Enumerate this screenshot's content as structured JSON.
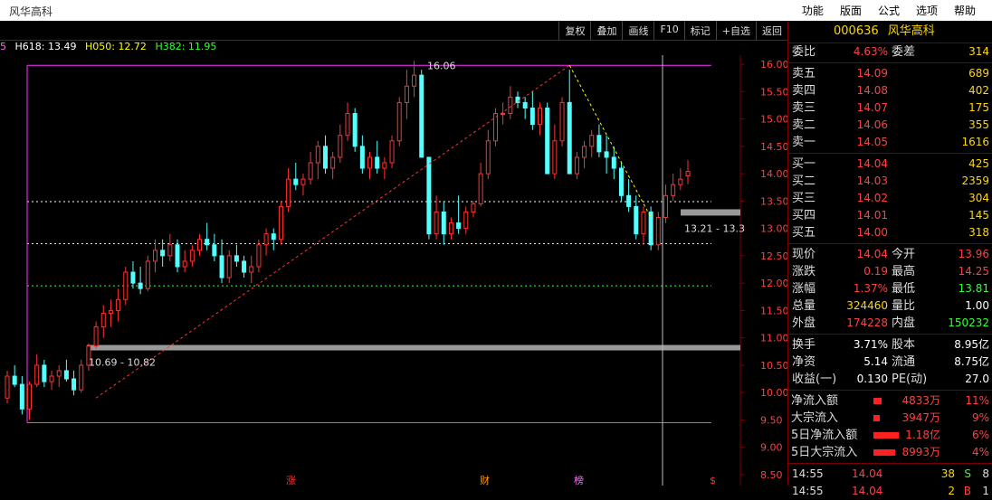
{
  "window": {
    "title": "风华高科"
  },
  "menu": [
    "功能",
    "版面",
    "公式",
    "选项",
    "帮助"
  ],
  "toolbar": [
    "复权",
    "叠加",
    "画线",
    "F10",
    "标记",
    "+自选",
    "返回"
  ],
  "legend": {
    "prefix": "5",
    "h618": "H618: 13.49",
    "h050": "H050: 12.72",
    "h382": "H382: 11.95",
    "colors": {
      "h618": "#ffffff",
      "h050": "#ffff00",
      "h382": "#33ff33"
    }
  },
  "chart_data": {
    "type": "candlestick",
    "y_ticks": [
      "16.00",
      "15.50",
      "15.00",
      "14.50",
      "14.00",
      "13.50",
      "13.00",
      "12.50",
      "12.00",
      "11.50",
      "11.00",
      "10.50",
      "10.00",
      "9.50",
      "9.00",
      "8.50"
    ],
    "ylim": [
      8.4,
      16.1
    ],
    "fib_levels": [
      {
        "value": 13.49,
        "color": "#ffffff"
      },
      {
        "value": 12.72,
        "color": "#ffff00"
      },
      {
        "value": 11.95,
        "color": "#33ff33"
      }
    ],
    "high_label": "16.06",
    "range_label_low": "10.69 - 10.82",
    "range_label_high": "13.21 - 13.3",
    "markers": [
      "涨",
      "财",
      "榜",
      "$"
    ],
    "candles": [
      [
        9.9,
        10.4,
        9.8,
        10.3
      ],
      [
        10.3,
        10.5,
        10.1,
        10.15
      ],
      [
        10.15,
        10.3,
        9.6,
        9.7
      ],
      [
        9.7,
        10.2,
        9.5,
        10.15
      ],
      [
        10.15,
        10.7,
        10.1,
        10.5
      ],
      [
        10.5,
        10.6,
        10.1,
        10.2
      ],
      [
        10.2,
        10.4,
        10.05,
        10.3
      ],
      [
        10.3,
        10.5,
        10.1,
        10.4
      ],
      [
        10.4,
        10.6,
        10.2,
        10.25
      ],
      [
        10.25,
        10.4,
        9.95,
        10.05
      ],
      [
        10.05,
        10.6,
        10.0,
        10.5
      ],
      [
        10.5,
        10.9,
        10.4,
        10.85
      ],
      [
        10.85,
        11.3,
        10.8,
        11.2
      ],
      [
        11.2,
        11.6,
        11.0,
        11.45
      ],
      [
        11.45,
        11.7,
        11.2,
        11.5
      ],
      [
        11.5,
        11.9,
        11.3,
        11.7
      ],
      [
        11.7,
        12.3,
        11.6,
        12.2
      ],
      [
        12.2,
        12.4,
        11.9,
        12.0
      ],
      [
        12.0,
        12.3,
        11.8,
        11.9
      ],
      [
        11.9,
        12.5,
        11.85,
        12.4
      ],
      [
        12.4,
        12.8,
        12.2,
        12.6
      ],
      [
        12.6,
        12.8,
        12.3,
        12.5
      ],
      [
        12.5,
        12.9,
        12.4,
        12.7
      ],
      [
        12.7,
        12.8,
        12.2,
        12.3
      ],
      [
        12.3,
        12.6,
        12.2,
        12.4
      ],
      [
        12.4,
        12.7,
        12.3,
        12.6
      ],
      [
        12.6,
        12.9,
        12.5,
        12.8
      ],
      [
        12.8,
        13.1,
        12.6,
        12.7
      ],
      [
        12.7,
        12.9,
        12.4,
        12.5
      ],
      [
        12.5,
        12.8,
        12.0,
        12.1
      ],
      [
        12.1,
        12.6,
        12.0,
        12.5
      ],
      [
        12.5,
        12.7,
        12.3,
        12.4
      ],
      [
        12.4,
        12.5,
        12.1,
        12.2
      ],
      [
        12.2,
        12.5,
        12.0,
        12.3
      ],
      [
        12.3,
        12.8,
        12.2,
        12.7
      ],
      [
        12.7,
        13.0,
        12.5,
        12.9
      ],
      [
        12.9,
        13.0,
        12.6,
        12.8
      ],
      [
        12.8,
        13.5,
        12.7,
        13.4
      ],
      [
        13.4,
        14.1,
        13.3,
        13.9
      ],
      [
        13.9,
        14.2,
        13.7,
        13.8
      ],
      [
        13.8,
        14.0,
        13.6,
        13.9
      ],
      [
        13.9,
        14.4,
        13.8,
        14.2
      ],
      [
        14.2,
        14.6,
        13.9,
        14.5
      ],
      [
        14.5,
        14.7,
        14.0,
        14.1
      ],
      [
        14.1,
        14.4,
        13.9,
        14.3
      ],
      [
        14.3,
        14.9,
        14.2,
        14.7
      ],
      [
        14.7,
        15.3,
        14.6,
        15.1
      ],
      [
        15.1,
        15.2,
        14.4,
        14.5
      ],
      [
        14.5,
        14.7,
        14.0,
        14.1
      ],
      [
        14.1,
        14.4,
        13.9,
        14.3
      ],
      [
        14.3,
        14.6,
        14.0,
        14.1
      ],
      [
        14.1,
        14.3,
        13.9,
        14.2
      ],
      [
        14.2,
        14.7,
        14.1,
        14.6
      ],
      [
        14.6,
        15.4,
        14.5,
        15.3
      ],
      [
        15.3,
        15.9,
        15.0,
        15.6
      ],
      [
        15.6,
        16.06,
        15.4,
        15.8
      ],
      [
        15.8,
        15.9,
        14.3,
        14.3
      ],
      [
        14.3,
        13.5,
        12.8,
        12.9
      ],
      [
        12.9,
        13.6,
        12.8,
        13.3
      ],
      [
        13.3,
        13.5,
        12.7,
        12.9
      ],
      [
        12.9,
        13.2,
        12.8,
        13.1
      ],
      [
        13.1,
        13.6,
        12.9,
        13.0
      ],
      [
        13.0,
        13.4,
        12.9,
        13.3
      ],
      [
        13.3,
        13.5,
        13.2,
        13.45
      ],
      [
        13.45,
        14.2,
        13.4,
        14.0
      ],
      [
        14.0,
        14.8,
        13.9,
        14.6
      ],
      [
        14.6,
        15.2,
        14.5,
        15.1
      ],
      [
        15.1,
        15.3,
        14.9,
        15.1
      ],
      [
        15.1,
        15.6,
        15.0,
        15.4
      ],
      [
        15.4,
        15.5,
        15.2,
        15.3
      ],
      [
        15.3,
        15.4,
        15.0,
        15.2
      ],
      [
        15.2,
        15.5,
        14.8,
        14.9
      ],
      [
        14.9,
        15.3,
        14.7,
        15.2
      ],
      [
        15.2,
        15.3,
        14.4,
        14.0
      ],
      [
        14.0,
        14.9,
        13.9,
        14.6
      ],
      [
        14.6,
        15.4,
        14.5,
        15.3
      ],
      [
        15.3,
        15.9,
        14.3,
        14.0
      ],
      [
        14.0,
        14.4,
        13.9,
        14.3
      ],
      [
        14.3,
        14.6,
        14.1,
        14.5
      ],
      [
        14.5,
        14.8,
        14.3,
        14.7
      ],
      [
        14.7,
        14.9,
        14.3,
        14.4
      ],
      [
        14.4,
        14.7,
        14.0,
        14.3
      ],
      [
        14.3,
        14.5,
        13.9,
        14.1
      ],
      [
        14.1,
        14.2,
        13.5,
        13.6
      ],
      [
        13.6,
        13.9,
        13.3,
        13.4
      ],
      [
        13.4,
        13.6,
        12.8,
        12.9
      ],
      [
        12.9,
        13.4,
        12.7,
        13.3
      ],
      [
        13.3,
        13.4,
        12.6,
        12.7
      ],
      [
        12.7,
        13.3,
        12.6,
        13.2
      ],
      [
        13.2,
        13.8,
        13.1,
        13.6
      ],
      [
        13.6,
        14.0,
        13.5,
        13.8
      ],
      [
        13.8,
        14.1,
        13.7,
        13.9
      ],
      [
        13.96,
        14.25,
        13.81,
        14.04
      ]
    ]
  },
  "panel": {
    "code": "000636",
    "name": "风华高科",
    "ratio": {
      "label": "委比",
      "value": "4.63%",
      "label2": "委差",
      "value2": "314"
    },
    "asks": [
      {
        "label": "卖五",
        "price": "14.09",
        "vol": "689"
      },
      {
        "label": "卖四",
        "price": "14.08",
        "vol": "402"
      },
      {
        "label": "卖三",
        "price": "14.07",
        "vol": "175"
      },
      {
        "label": "卖二",
        "price": "14.06",
        "vol": "355"
      },
      {
        "label": "卖一",
        "price": "14.05",
        "vol": "1616"
      }
    ],
    "bids": [
      {
        "label": "买一",
        "price": "14.04",
        "vol": "425"
      },
      {
        "label": "买二",
        "price": "14.03",
        "vol": "2359"
      },
      {
        "label": "买三",
        "price": "14.02",
        "vol": "304"
      },
      {
        "label": "买四",
        "price": "14.01",
        "vol": "145"
      },
      {
        "label": "买五",
        "price": "14.00",
        "vol": "318"
      }
    ],
    "quote": [
      {
        "l1": "现价",
        "v1": "14.04",
        "l2": "今开",
        "v2": "13.96",
        "c2": "#ff4040"
      },
      {
        "l1": "涨跌",
        "v1": "0.19",
        "l2": "最高",
        "v2": "14.25",
        "c2": "#ff4040"
      },
      {
        "l1": "涨幅",
        "v1": "1.37%",
        "l2": "最低",
        "v2": "13.81",
        "c2": "#33ff33"
      },
      {
        "l1": "总量",
        "v1": "324460",
        "l2": "量比",
        "v2": "1.00",
        "c1": "#ffd700",
        "c2": "#ffffff"
      },
      {
        "l1": "外盘",
        "v1": "174228",
        "l2": "内盘",
        "v2": "150232",
        "c2": "#33ff33"
      }
    ],
    "fund": [
      {
        "l1": "换手",
        "v1": "3.71%",
        "l2": "股本",
        "v2": "8.95亿"
      },
      {
        "l1": "净资",
        "v1": "5.14",
        "l2": "流通",
        "v2": "8.75亿"
      },
      {
        "l1": "收益(一)",
        "v1": "0.130",
        "l2": "PE(动)",
        "v2": "27.0"
      }
    ],
    "flow": [
      {
        "label": "净流入额",
        "amount": "4833万",
        "pct": "11%",
        "bar": 0.11
      },
      {
        "label": "大宗流入",
        "amount": "3947万",
        "pct": "9%",
        "bar": 0.09
      },
      {
        "label": "5日净流入额",
        "amount": "1.18亿",
        "pct": "6%",
        "bar": 0.35
      },
      {
        "label": "5日大宗流入",
        "amount": "8993万",
        "pct": "4%",
        "bar": 0.3
      }
    ],
    "ticks": [
      {
        "time": "14:55",
        "price": "14.04",
        "vol": "38",
        "bs": "S",
        "n": "8",
        "bsColor": "#33ff33"
      },
      {
        "time": "14:55",
        "price": "14.04",
        "vol": "2",
        "bs": "B",
        "n": "1",
        "bsColor": "#ff4040"
      }
    ]
  }
}
